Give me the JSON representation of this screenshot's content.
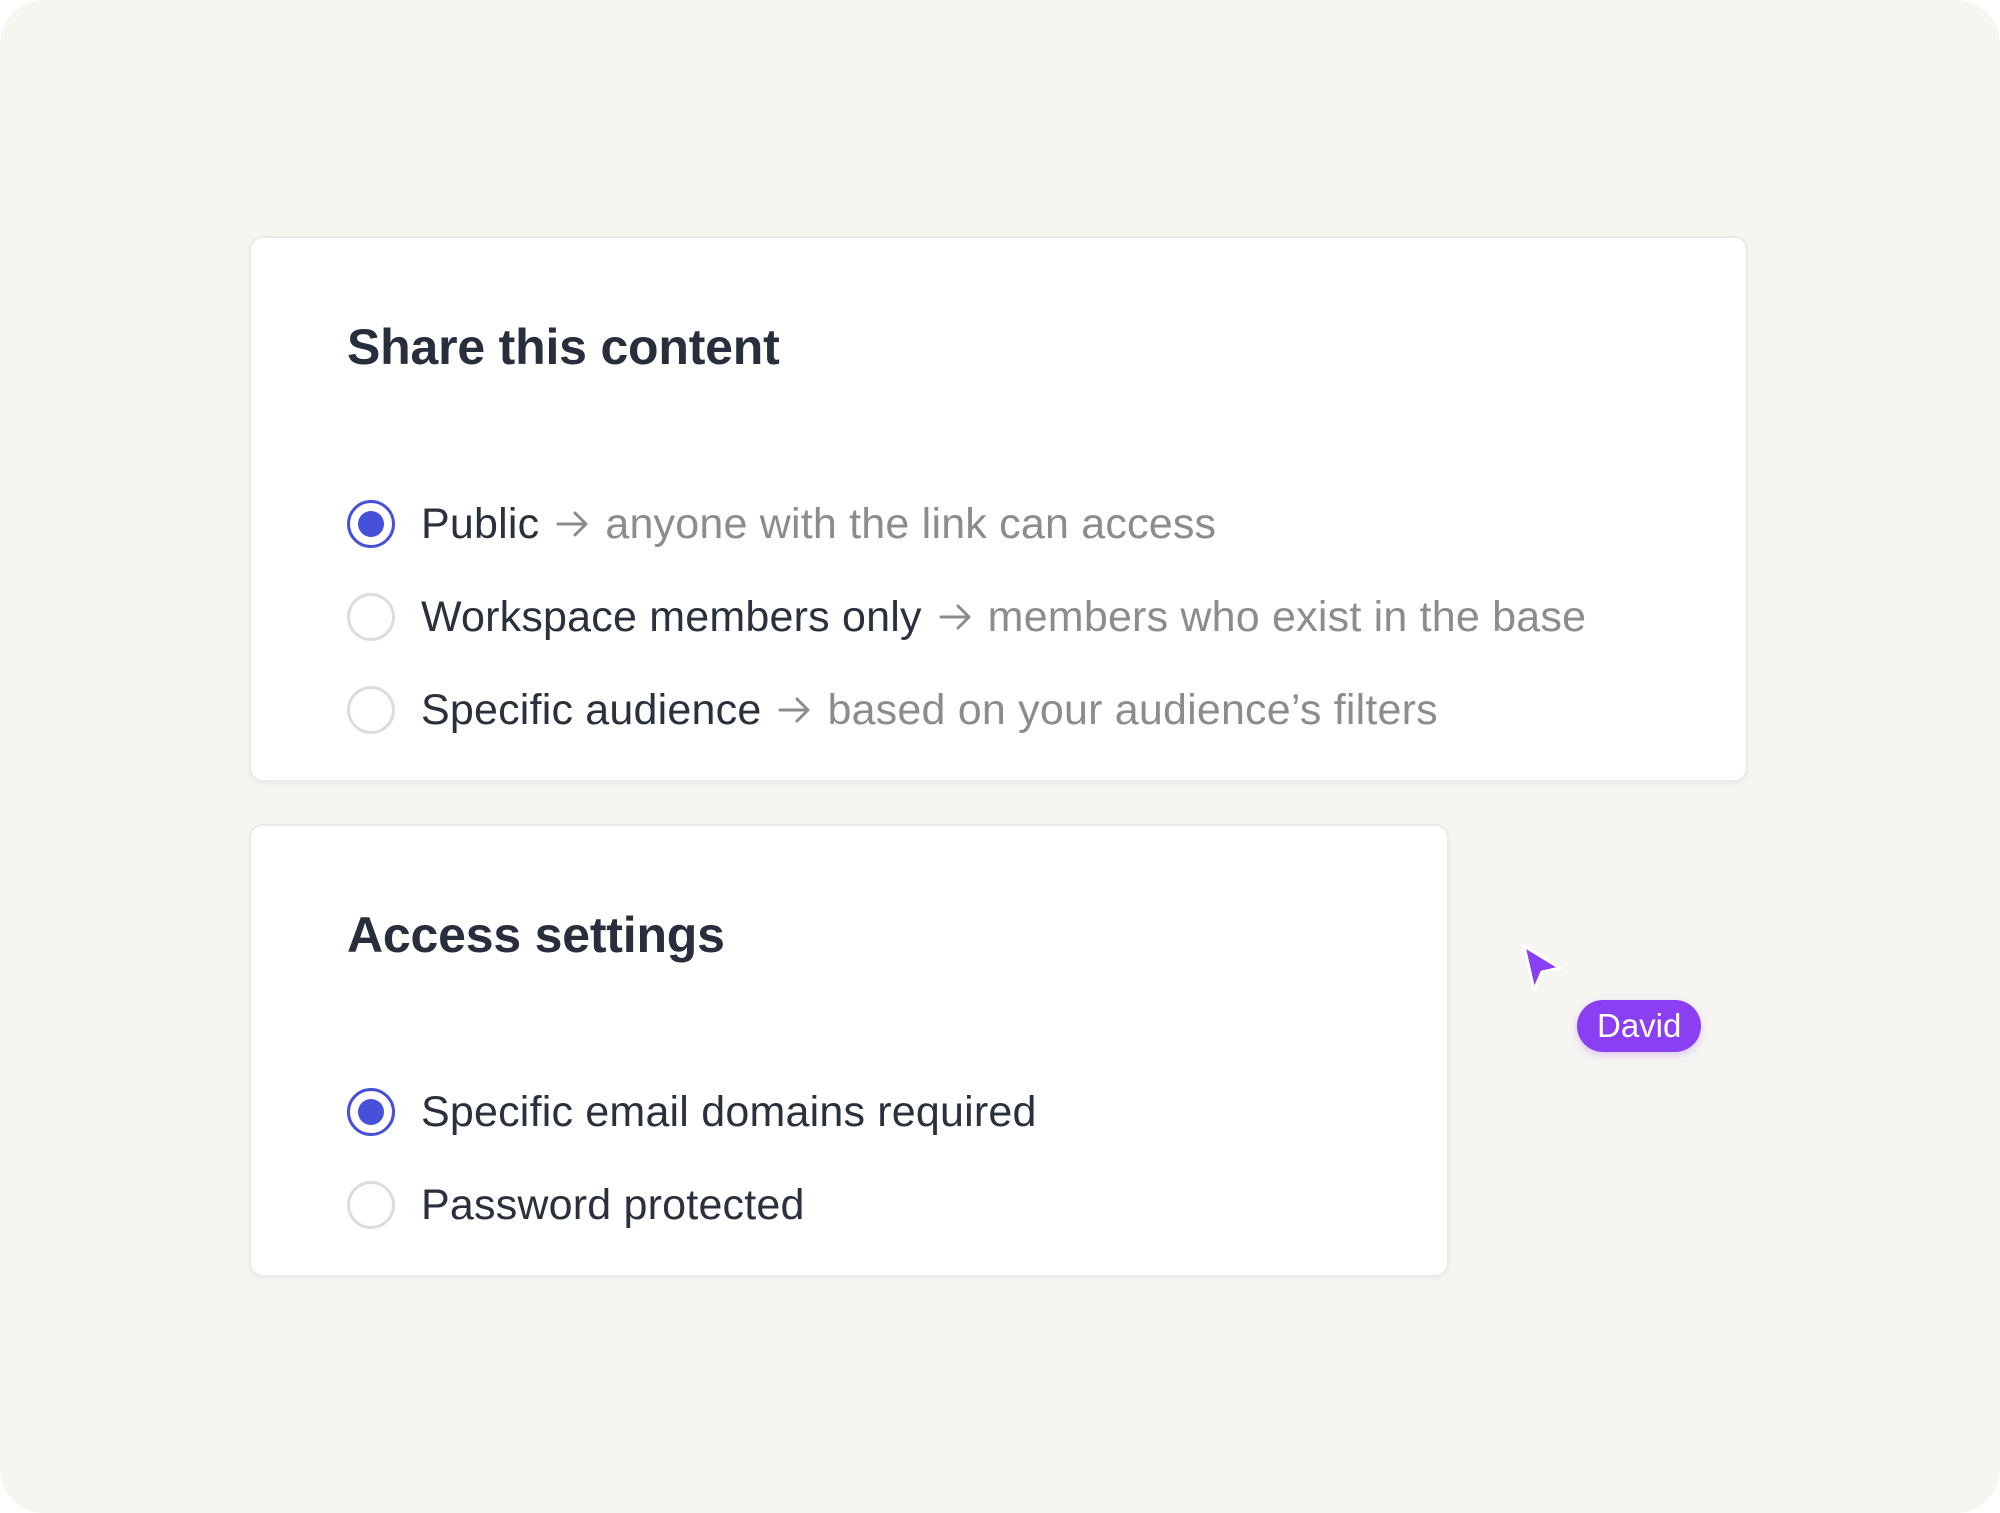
{
  "share_card": {
    "title": "Share this content",
    "options": [
      {
        "label": "Public",
        "description": "anyone with the link can access",
        "selected": true
      },
      {
        "label": "Workspace members only",
        "description": "members who exist in the base",
        "selected": false
      },
      {
        "label": "Specific audience",
        "description": "based on your audience’s filters",
        "selected": false
      }
    ]
  },
  "access_card": {
    "title": "Access settings",
    "options": [
      {
        "label": "Specific email domains required",
        "selected": true
      },
      {
        "label": "Password protected",
        "selected": false
      }
    ]
  },
  "collaborator": {
    "name": "David",
    "color": "#8b3ff2"
  },
  "colors": {
    "accent": "#4650d8",
    "background": "#f6f5f2",
    "text": "#2a303c",
    "muted_text": "#8c8c8c"
  }
}
